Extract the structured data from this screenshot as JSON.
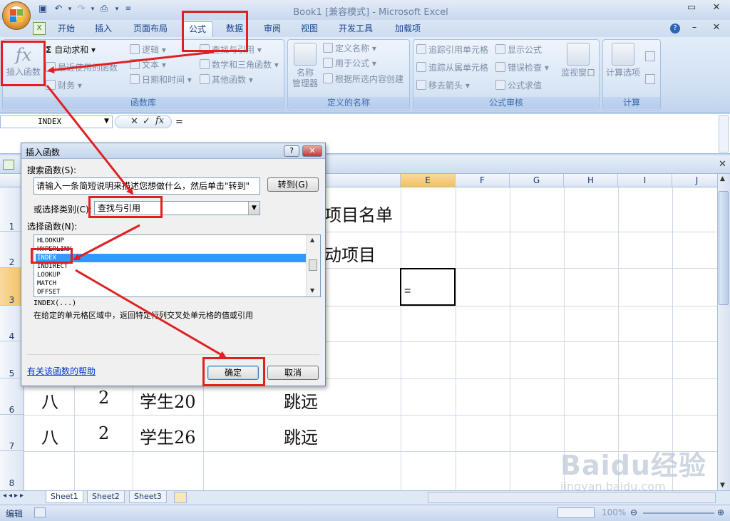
{
  "window": {
    "title": "Book1  [兼容模式] - Microsoft Excel"
  },
  "tabs": [
    {
      "label": "开始"
    },
    {
      "label": "插入"
    },
    {
      "label": "页面布局"
    },
    {
      "label": "公式",
      "active": true
    },
    {
      "label": "数据"
    },
    {
      "label": "审阅"
    },
    {
      "label": "视图"
    },
    {
      "label": "开发工具"
    },
    {
      "label": "加载项"
    }
  ],
  "ribbon": {
    "insert_function": {
      "icon": "fx",
      "label": "插入函数"
    },
    "autosum": "自动求和",
    "recent": "最近使用的函数",
    "financial": "财务",
    "logical": "逻辑",
    "text": "文本",
    "datetime": "日期和时间",
    "lookup": "查找与引用",
    "math": "数学和三角函数",
    "other": "其他函数",
    "group_library": "函数库",
    "name_manager_1": "名称",
    "name_manager_2": "管理器",
    "define_name": "定义名称",
    "use_in_formula": "用于公式",
    "create_from_selection": "根据所选内容创建",
    "group_names": "定义的名称",
    "trace_precedents": "追踪引用单元格",
    "trace_dependents": "追踪从属单元格",
    "remove_arrows": "移去箭头",
    "show_formulas": "显示公式",
    "error_checking": "错误检查",
    "evaluate_formula": "公式求值",
    "watch_window": "监视窗口",
    "group_auditing": "公式审核",
    "calc_options": "计算选项",
    "group_calc": "计算"
  },
  "formula_bar": {
    "name_box": "INDEX",
    "formula": "="
  },
  "grid": {
    "columns": [
      "E",
      "F",
      "G",
      "H",
      "I",
      "J"
    ],
    "rows": [
      "1",
      "2",
      "3",
      "4",
      "5",
      "6",
      "7",
      "8"
    ],
    "cells": {
      "r1_title": "项目名单",
      "r2_title": "动项目",
      "r6": [
        "八",
        "2",
        "学生20",
        "跳远"
      ],
      "r7": [
        "八",
        "2",
        "学生26",
        "跳远"
      ],
      "active_cell": "="
    }
  },
  "dialog": {
    "title": "插入函数",
    "search_label": "搜索函数(S):",
    "search_value": "请输入一条简短说明来描述您想做什么，然后单击\"转到\"",
    "goto_button": "转到(G)",
    "category_label": "或选择类别(C):",
    "category_value": "查找与引用",
    "select_label": "选择函数(N):",
    "functions": [
      "HLOOKUP",
      "HYPERLINK",
      "INDEX",
      "INDIRECT",
      "LOOKUP",
      "MATCH",
      "OFFSET"
    ],
    "selected_function": "INDEX",
    "signature": "INDEX(...)",
    "description": "在给定的单元格区域中，返回特定行列交叉处单元格的值或引用",
    "help_link": "有关该函数的帮助",
    "ok_button": "确定",
    "cancel_button": "取消"
  },
  "sheets": [
    "Sheet1",
    "Sheet2",
    "Sheet3"
  ],
  "status": {
    "mode": "编辑",
    "zoom": "100%"
  },
  "watermark": {
    "brand": "Baidu经验",
    "url": "jingyan.baidu.com"
  },
  "colors": {
    "annotation": "#e02020",
    "selection": "#3399ff",
    "accent": "#15428b"
  }
}
